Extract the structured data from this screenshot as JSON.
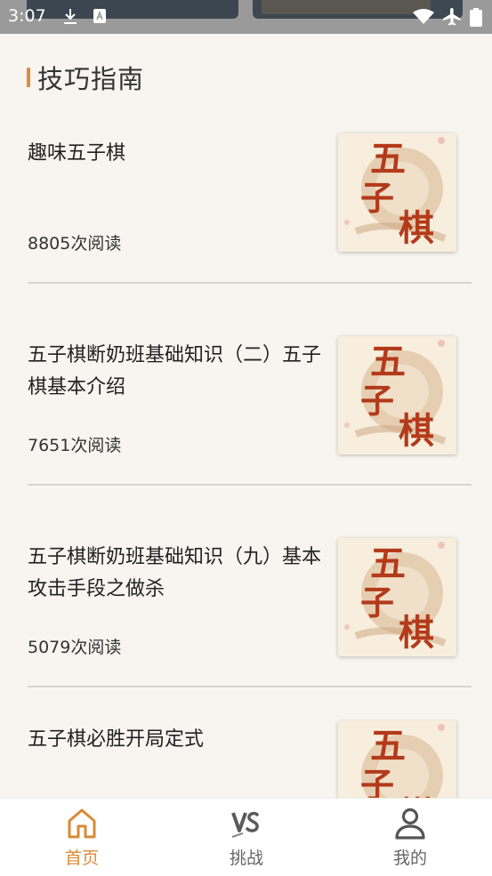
{
  "status_bar": {
    "time": "3:07"
  },
  "section": {
    "title": "技巧指南"
  },
  "articles": [
    {
      "title": "趣味五子棋",
      "reads": "8805次阅读",
      "thumb_text": [
        "五",
        "子",
        "棋"
      ]
    },
    {
      "title": "五子棋断奶班基础知识（二）五子棋基本介绍",
      "reads": "7651次阅读",
      "thumb_text": [
        "五",
        "子",
        "棋"
      ]
    },
    {
      "title": "五子棋断奶班基础知识（九）基本攻击手段之做杀",
      "reads": "5079次阅读",
      "thumb_text": [
        "五",
        "子",
        "棋"
      ]
    },
    {
      "title": "五子棋必胜开局定式",
      "reads": "",
      "thumb_text": [
        "五",
        "子",
        "棋"
      ]
    }
  ],
  "tabs": [
    {
      "label": "首页",
      "icon": "home-icon",
      "active": true
    },
    {
      "label": "挑战",
      "icon": "vs-icon",
      "active": false
    },
    {
      "label": "我的",
      "icon": "user-icon",
      "active": false
    }
  ],
  "colors": {
    "accent": "#e08a3c",
    "active_tab": "#d98a36",
    "inactive_tab": "#666666",
    "background": "#f8f5f0"
  }
}
